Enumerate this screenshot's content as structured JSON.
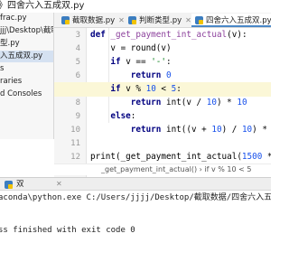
{
  "window": {
    "title": "》四舍六入五成双.py"
  },
  "project": {
    "items": [
      {
        "label": "frac.py"
      },
      {
        "label": "jjj\\Desktop\\截取"
      },
      {
        "label": "型.py"
      },
      {
        "label": "入五成双.py"
      },
      {
        "label": "s"
      },
      {
        "label": "raries"
      },
      {
        "label": "d Consoles"
      }
    ]
  },
  "tabs": [
    {
      "label": "截取数据.py"
    },
    {
      "label": "判断类型.py"
    },
    {
      "label": "四舍六入五成双.py"
    }
  ],
  "editor": {
    "line_numbers": [
      "3",
      "4",
      "5",
      "6",
      "7",
      "8",
      "9",
      "10",
      "11",
      "12",
      "13"
    ],
    "breadcrumb": "_get_payment_int_actual()  ›  if v % 10 < 5"
  },
  "console": {
    "run_tab_label": "双",
    "command": "aconda\\python.exe C:/Users/jjjj/Desktop/截取数据/四舍六入五成双",
    "exit_message": "ss finished with exit code 0"
  },
  "colors": {
    "keyword": "#000080",
    "function": "#8b3f9b",
    "number": "#1750eb",
    "string": "#067d17",
    "current_line": "#fbf7d7",
    "tab_active_underline": "#4a88c7"
  }
}
